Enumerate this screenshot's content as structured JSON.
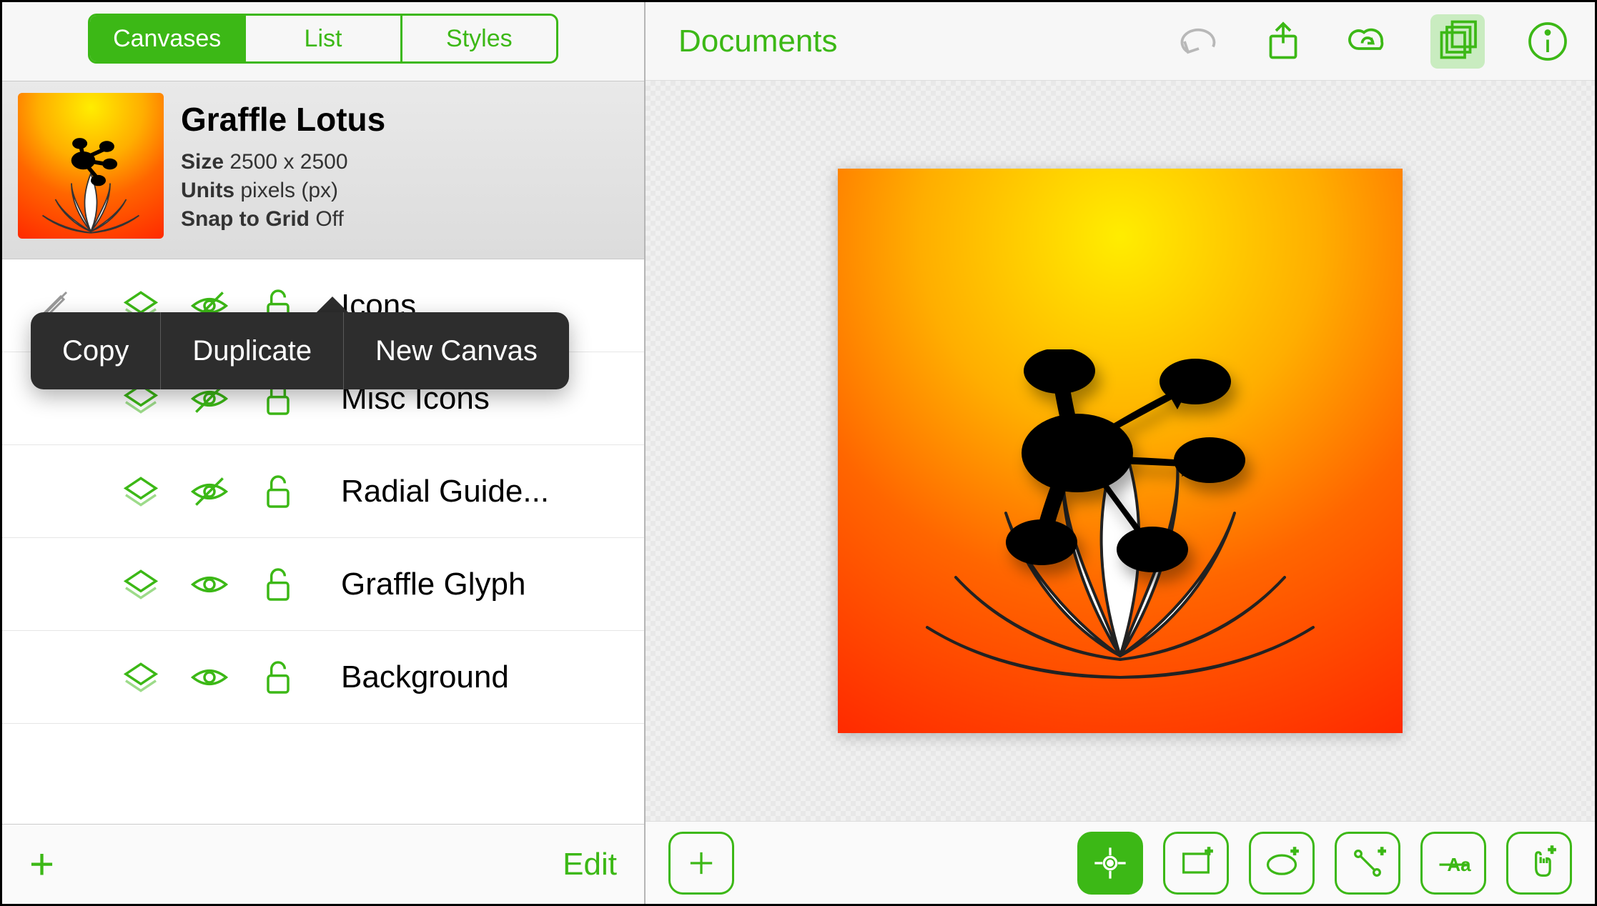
{
  "segmented": {
    "canvases": "Canvases",
    "list": "List",
    "styles": "Styles",
    "active": 0
  },
  "canvas": {
    "title": "Graffle Lotus",
    "size_label": "Size",
    "size_value": "2500 x 2500",
    "units_label": "Units",
    "units_value": "pixels (px)",
    "snap_label": "Snap to Grid",
    "snap_value": "Off"
  },
  "popover": {
    "copy": "Copy",
    "duplicate": "Duplicate",
    "new_canvas": "New Canvas"
  },
  "layers": [
    {
      "name": "Icons",
      "shared": true,
      "visible": false,
      "locked": false,
      "pencil_dim": true
    },
    {
      "name": "Misc Icons",
      "shared": true,
      "visible": false,
      "locked": true,
      "pencil_dim": false
    },
    {
      "name": "Radial Guide...",
      "shared": true,
      "visible": false,
      "locked": false,
      "pencil_dim": false
    },
    {
      "name": "Graffle Glyph",
      "shared": true,
      "visible": true,
      "locked": false,
      "pencil_dim": false
    },
    {
      "name": "Background",
      "shared": true,
      "visible": true,
      "locked": false,
      "pencil_dim": false
    }
  ],
  "sidebar_bottom": {
    "add": "+",
    "edit": "Edit"
  },
  "main": {
    "documents": "Documents"
  },
  "icons": {
    "undo": "undo-icon",
    "share": "share-icon",
    "sync": "cloud-sync-icon",
    "canvases": "canvases-icon",
    "info": "info-icon",
    "add_shape": "plus-square-icon",
    "select": "crosshair-icon",
    "rect": "rectangle-icon",
    "ellipse": "ellipse-icon",
    "line": "line-tool-icon",
    "text": "text-tool-icon",
    "touch": "touch-icon"
  },
  "colors": {
    "accent": "#3cb816",
    "popover": "#2d2d2d"
  }
}
